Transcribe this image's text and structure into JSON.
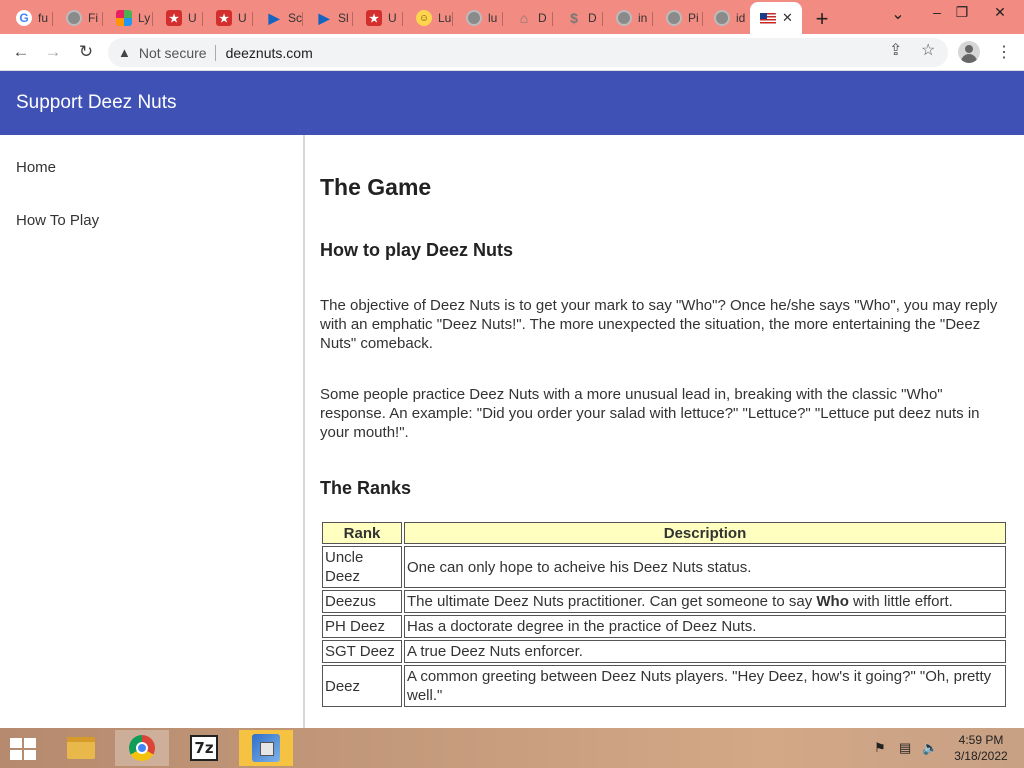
{
  "browser": {
    "tabs": [
      {
        "favicon": "google-g-icon",
        "title": "fu"
      },
      {
        "favicon": "globe-icon",
        "title": "Fi"
      },
      {
        "favicon": "colorful-app-icon",
        "title": "Ly"
      },
      {
        "favicon": "red-star-icon",
        "title": "U"
      },
      {
        "favicon": "red-star-icon",
        "title": "U"
      },
      {
        "favicon": "play-arrow-icon",
        "title": "Sc"
      },
      {
        "favicon": "play-arrow-icon",
        "title": "Sl"
      },
      {
        "favicon": "red-star-icon",
        "title": "U"
      },
      {
        "favicon": "smiley-icon",
        "title": "Lu"
      },
      {
        "favicon": "globe-icon",
        "title": "lu"
      },
      {
        "favicon": "pin-icon",
        "title": "D"
      },
      {
        "favicon": "dollar-icon",
        "title": "D"
      },
      {
        "favicon": "globe-icon",
        "title": "in"
      },
      {
        "favicon": "globe-icon",
        "title": "Pi"
      },
      {
        "favicon": "globe-icon",
        "title": "id"
      }
    ],
    "active_tab": {
      "favicon": "us-flag-icon",
      "close": "✕"
    },
    "new_tab": "+",
    "controls": {
      "tab_search": "⌄",
      "minimize": "–",
      "restore": "❐",
      "close": "✕"
    },
    "security_label": "Not secure",
    "url": "deeznuts.com"
  },
  "site": {
    "title": "Support Deez Nuts",
    "nav": [
      "Home",
      "How To Play"
    ]
  },
  "content": {
    "heading": "The Game",
    "subheading": "How to play Deez Nuts",
    "paragraph1": "The objective of Deez Nuts is to get your mark to say \"Who\"? Once he/she says \"Who\", you may reply with an emphatic \"Deez Nuts!\". The more unexpected the situation, the more entertaining the \"Deez Nuts\" comeback.",
    "paragraph2": "Some people practice Deez Nuts with a more unusual lead in, breaking with the classic \"Who\" response. An example: \"Did you order your salad with lettuce?\" \"Lettuce?\" \"Lettuce put deez nuts in your mouth!\".",
    "ranks_heading": "The Ranks",
    "ranks_table": {
      "headers": [
        "Rank",
        "Description"
      ],
      "rows": [
        {
          "rank": "Uncle Deez",
          "description": "One can only hope to acheive his Deez Nuts status."
        },
        {
          "rank": "Deezus",
          "description_before": "The ultimate Deez Nuts practitioner. Can get someone to say ",
          "description_bold": "Who",
          "description_after": " with little effort."
        },
        {
          "rank": "PH Deez",
          "description": "Has a doctorate degree in the practice of Deez Nuts."
        },
        {
          "rank": "SGT Deez",
          "description": "A true Deez Nuts enforcer."
        },
        {
          "rank": "Deez",
          "description": "A common greeting between Deez Nuts players. \"Hey Deez, how's it going?\" \"Oh, pretty well.\""
        }
      ]
    }
  },
  "taskbar": {
    "apps": [
      "file-explorer-icon",
      "chrome-icon",
      "7zip-icon",
      "app-installer-icon"
    ],
    "time": "4:59 PM",
    "date": "3/18/2022"
  }
}
